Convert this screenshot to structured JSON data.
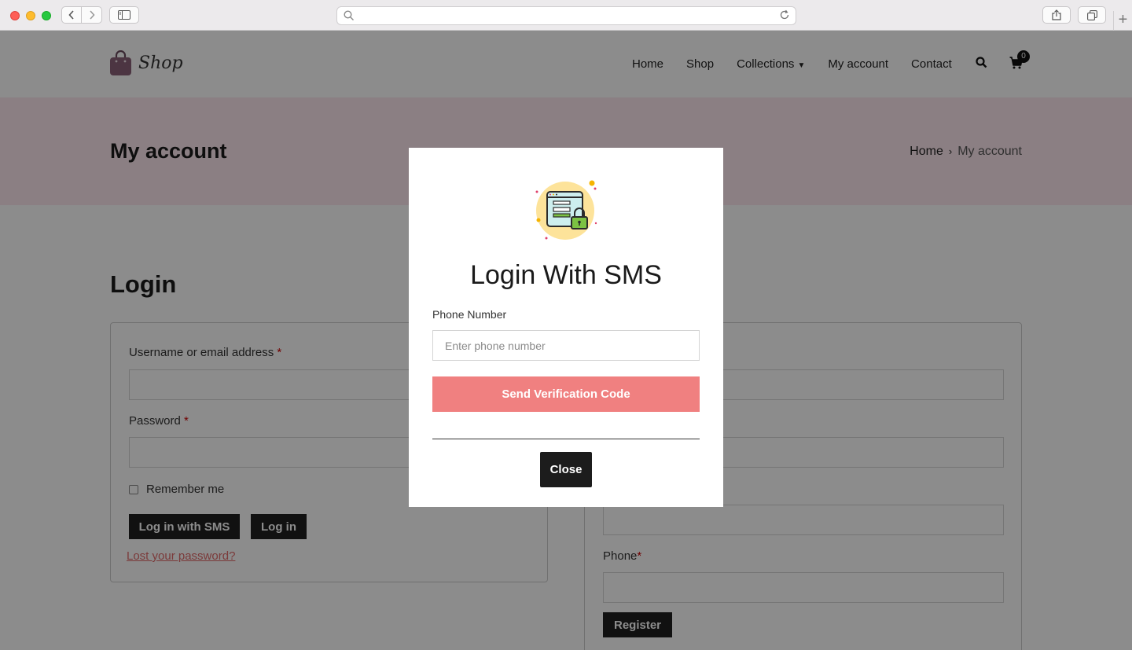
{
  "browser": {
    "address_placeholder": "",
    "light_colors": [
      "#fe5f57",
      "#febc2e",
      "#28c840"
    ]
  },
  "site": {
    "logo_text": "Shop",
    "menu": [
      "Home",
      "Shop",
      "Collections",
      "My account",
      "Contact"
    ],
    "cart_count": "0"
  },
  "hero": {
    "title": "My account",
    "breadcrumb_home": "Home",
    "breadcrumb_sep": "›",
    "breadcrumb_current": "My account"
  },
  "login": {
    "heading": "Login",
    "username_label": "Username or email address",
    "password_label": "Password",
    "required_mark": "*",
    "remember_label": "Remember me",
    "sms_button": "Log in with SMS",
    "login_button": "Log in",
    "lost_password": "Lost your password?"
  },
  "register": {
    "phone_label": "Phone",
    "required_mark": "*",
    "register_button": "Register"
  },
  "modal": {
    "title": "Login With SMS",
    "phone_label": "Phone Number",
    "phone_placeholder": "Enter phone number",
    "send_button": "Send Verification Code",
    "close_button": "Close",
    "accent_color": "#f08080"
  }
}
